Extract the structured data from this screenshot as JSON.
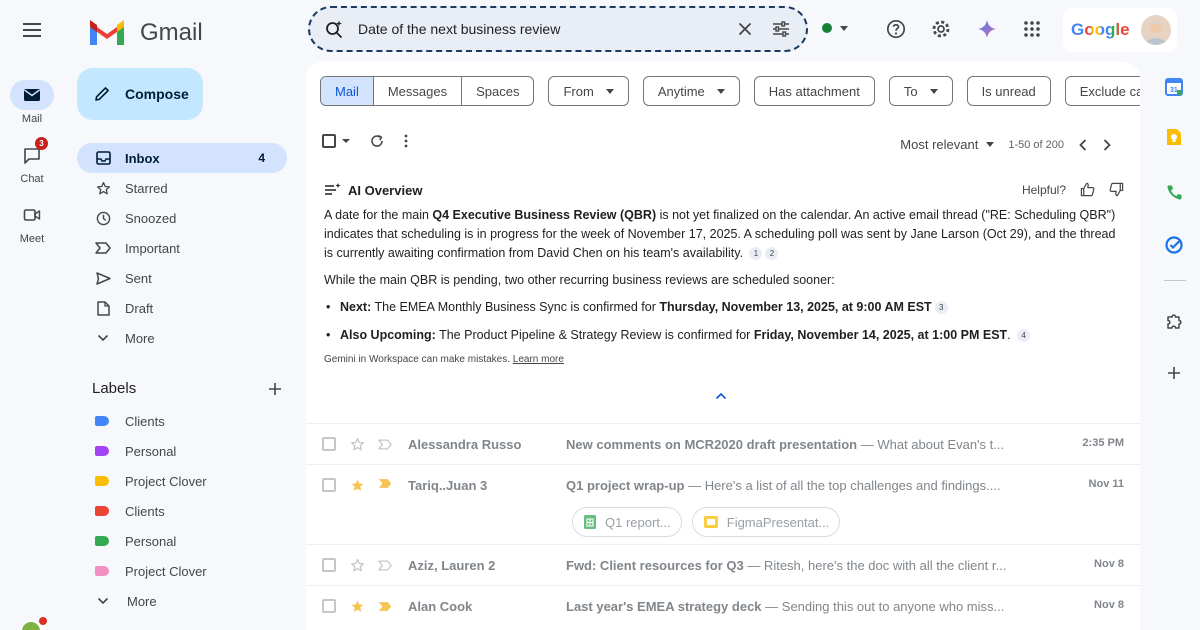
{
  "app": {
    "name": "Gmail"
  },
  "rail": {
    "items": [
      {
        "label": "Mail",
        "badge": ""
      },
      {
        "label": "Chat",
        "badge": "3"
      },
      {
        "label": "Meet",
        "badge": ""
      }
    ]
  },
  "sidebar": {
    "compose_label": "Compose",
    "items": [
      {
        "label": "Inbox",
        "count": "4",
        "icon": "inbox-icon"
      },
      {
        "label": "Starred",
        "icon": "star-icon"
      },
      {
        "label": "Snoozed",
        "icon": "clock-icon"
      },
      {
        "label": "Important",
        "icon": "important-icon"
      },
      {
        "label": "Sent",
        "icon": "send-icon"
      },
      {
        "label": "Draft",
        "icon": "draft-icon"
      },
      {
        "label": "More",
        "icon": "chevron-down-icon"
      }
    ],
    "labels_title": "Labels",
    "labels": [
      {
        "label": "Clients",
        "color": "#4285f4"
      },
      {
        "label": "Personal",
        "color": "#a142f4"
      },
      {
        "label": "Project Clover",
        "color": "#fbbc04"
      },
      {
        "label": "Clients",
        "color": "#ea4335"
      },
      {
        "label": "Personal",
        "color": "#34a853"
      },
      {
        "label": "Project Clover",
        "color": "#f48fc4"
      }
    ],
    "labels_more": "More"
  },
  "search": {
    "query": "Date of the next business review"
  },
  "account": {
    "google_word": "Google"
  },
  "filters": {
    "segments": [
      "Mail",
      "Messages",
      "Spaces"
    ],
    "chips": [
      {
        "label": "From",
        "dropdown": true
      },
      {
        "label": "Anytime",
        "dropdown": true
      },
      {
        "label": "Has attachment",
        "dropdown": false
      },
      {
        "label": "To",
        "dropdown": true
      },
      {
        "label": "Is unread",
        "dropdown": false
      },
      {
        "label": "Exclude calendar updates",
        "dropdown": false
      }
    ]
  },
  "list_toolbar": {
    "sort_label": "Most relevant",
    "range": "1-50 of 200"
  },
  "ai_overview": {
    "title": "AI Overview",
    "helpful_label": "Helpful?",
    "p1_a": "A date for the main ",
    "p1_b": "Q4 Executive Business Review (QBR)",
    "p1_c": " is not yet finalized on the calendar. An active email thread (\"RE: Scheduling QBR\") indicates that scheduling is in progress for the week of November 17, 2025. A scheduling poll was sent by Jane Larson (Oct 29), and the thread is currently awaiting confirmation from David Chen on his team's availability.",
    "p1_cites": [
      "1",
      "2"
    ],
    "p2": "While the main QBR is pending, two other recurring business reviews are scheduled sooner:",
    "bullets": [
      {
        "lead": "Next:",
        "text": " The EMEA Monthly Business Sync is confirmed for ",
        "bold": "Thursday, November 13, 2025, at 9:00 AM EST",
        "tail": "",
        "cite": "3"
      },
      {
        "lead": "Also Upcoming:",
        "text": " The Product Pipeline & Strategy Review is confirmed for ",
        "bold": "Friday, November 14, 2025, at 1:00 PM EST",
        "tail": ".",
        "cite": "4"
      }
    ],
    "disclaimer": "Gemini in Workspace can make mistakes. ",
    "learn_more": "Learn more"
  },
  "emails": [
    {
      "sender": "Alessandra Russo",
      "subject": "New comments on MCR2020 draft presentation",
      "snippet": " — What about Evan's t...",
      "date": "2:35 PM",
      "starred": false,
      "important": false,
      "attachments": []
    },
    {
      "sender": "Tariq..Juan 3",
      "subject": "Q1 project wrap-up",
      "snippet": " — Here's a list of all the top challenges and findings....",
      "date": "Nov 11",
      "starred": true,
      "important": true,
      "attachments": [
        {
          "name": "Q1 report...",
          "type": "sheets"
        },
        {
          "name": "FigmaPresentat...",
          "type": "slides"
        }
      ]
    },
    {
      "sender": "Aziz, Lauren 2",
      "subject": "Fwd: Client resources for Q3",
      "snippet": " — Ritesh, here's the doc with all the client r...",
      "date": "Nov 8",
      "starred": false,
      "important": false,
      "attachments": []
    },
    {
      "sender": "Alan Cook",
      "subject": "Last year's EMEA strategy deck",
      "snippet": " — Sending this out to anyone who miss...",
      "date": "Nov 8",
      "starred": true,
      "important": true,
      "attachments": []
    }
  ],
  "colors": {
    "accent": "#0b57d0",
    "compose_bg": "#c2e7ff",
    "active_bg": "#d3e3fd",
    "star": "#fbbc04"
  }
}
